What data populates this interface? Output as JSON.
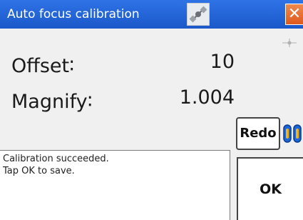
{
  "window": {
    "title": "Auto focus calibration",
    "title_icon": "satellite-icon",
    "close_label": "✕",
    "close_icon": "close-icon"
  },
  "results": {
    "offset_label": "Offset∶",
    "offset_value": "10",
    "magnify_label": "Magnify∶",
    "magnify_value": "1.004"
  },
  "buttons": {
    "redo_label": "Redo",
    "ok_label": "OK"
  },
  "message": {
    "line1": "Calibration succeeded.",
    "line2": "Tap OK to save."
  },
  "colors": {
    "titlebar": "#1b58c9",
    "close": "#de5a1e",
    "slider_blue": "#1d66d8",
    "slider_gold": "#f0b21f"
  }
}
